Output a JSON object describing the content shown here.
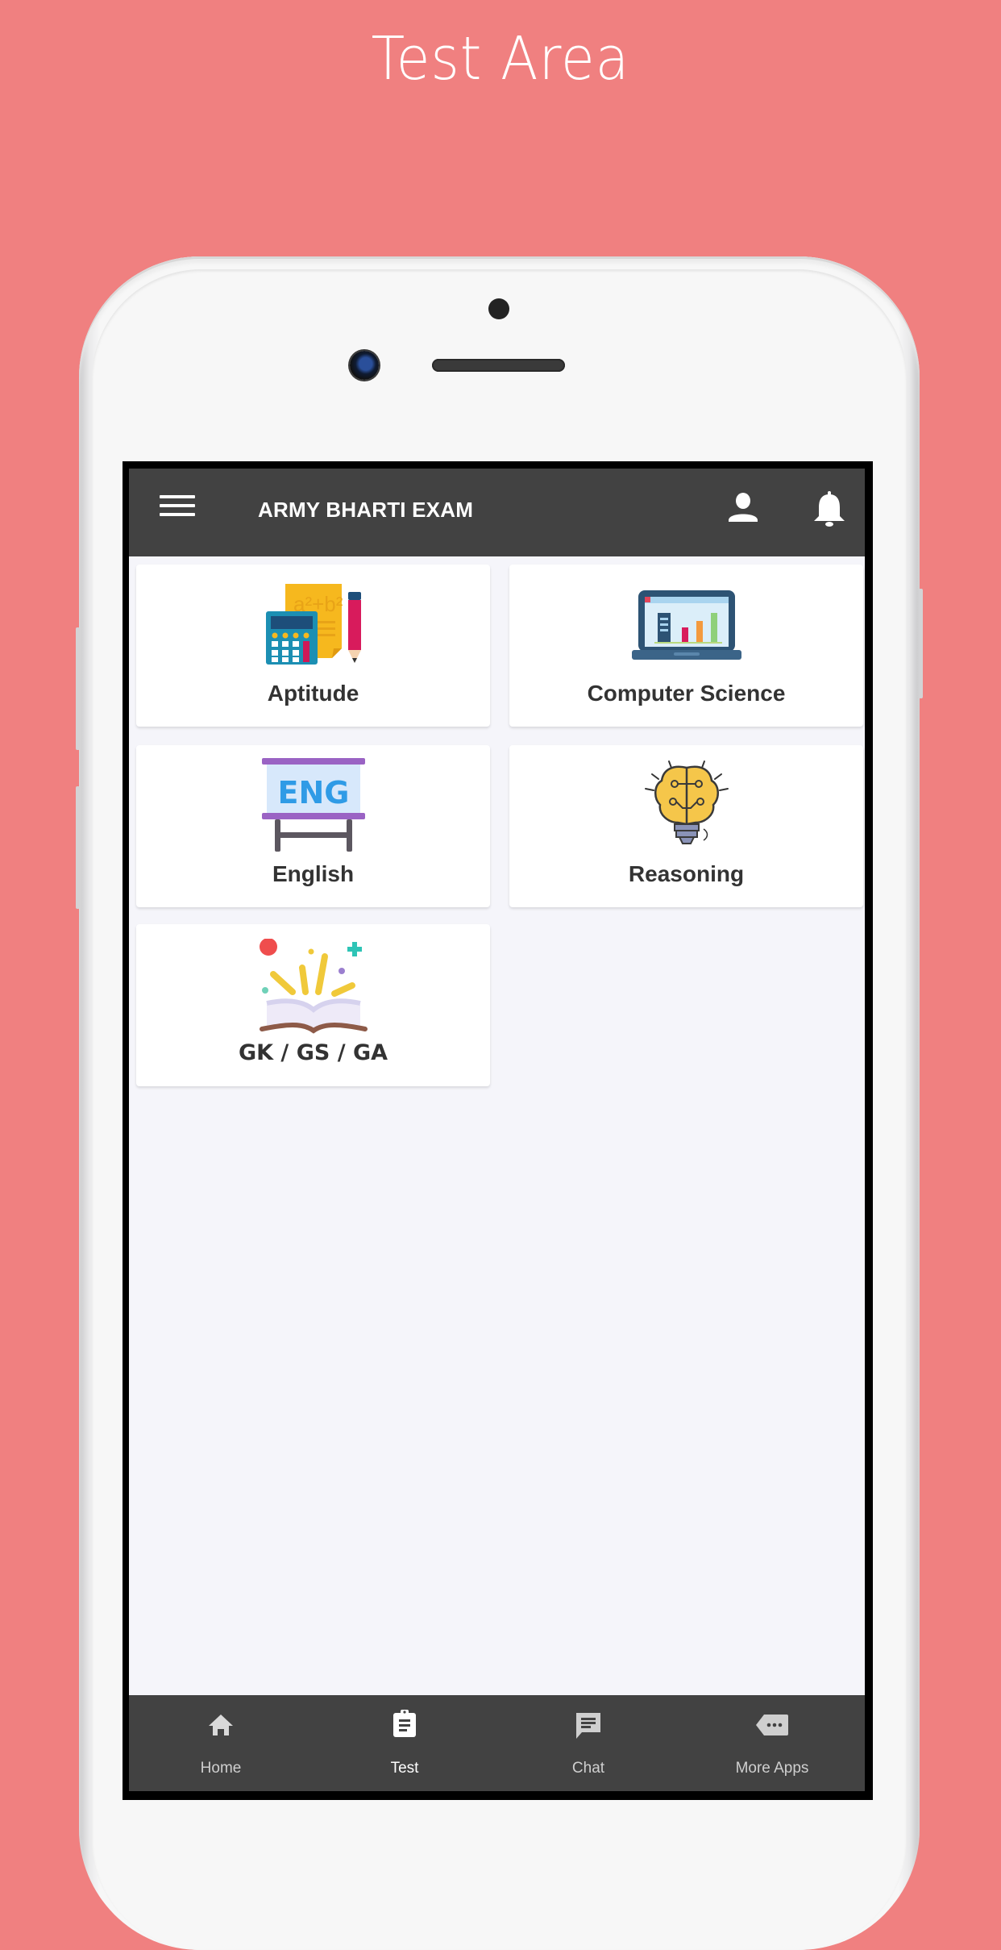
{
  "promo": {
    "title": "Test Area"
  },
  "colors": {
    "background": "#f08080",
    "appbar": "#424242",
    "screen_bg": "#f5f5fa",
    "card_bg": "#ffffff",
    "card_text": "#333333",
    "nav_active": "#ffffff",
    "nav_inactive": "#cfcfcf"
  },
  "appbar": {
    "title": "ARMY BHARTI EXAM",
    "menu_icon": "hamburger-menu-icon",
    "profile_icon": "person-icon",
    "notifications_icon": "bell-icon"
  },
  "categories": [
    {
      "label": "Aptitude",
      "icon": "calculator-formula-icon"
    },
    {
      "label": "Computer Science",
      "icon": "laptop-chart-icon"
    },
    {
      "label": "English",
      "icon": "eng-board-icon"
    },
    {
      "label": "Reasoning",
      "icon": "brain-bulb-icon"
    },
    {
      "label": "GK / GS / GA",
      "icon": "open-book-icon"
    }
  ],
  "bottom_nav": {
    "active": "Test",
    "items": [
      {
        "label": "Home",
        "icon": "home-icon"
      },
      {
        "label": "Test",
        "icon": "clipboard-icon"
      },
      {
        "label": "Chat",
        "icon": "chat-icon"
      },
      {
        "label": "More Apps",
        "icon": "more-apps-icon"
      }
    ]
  }
}
